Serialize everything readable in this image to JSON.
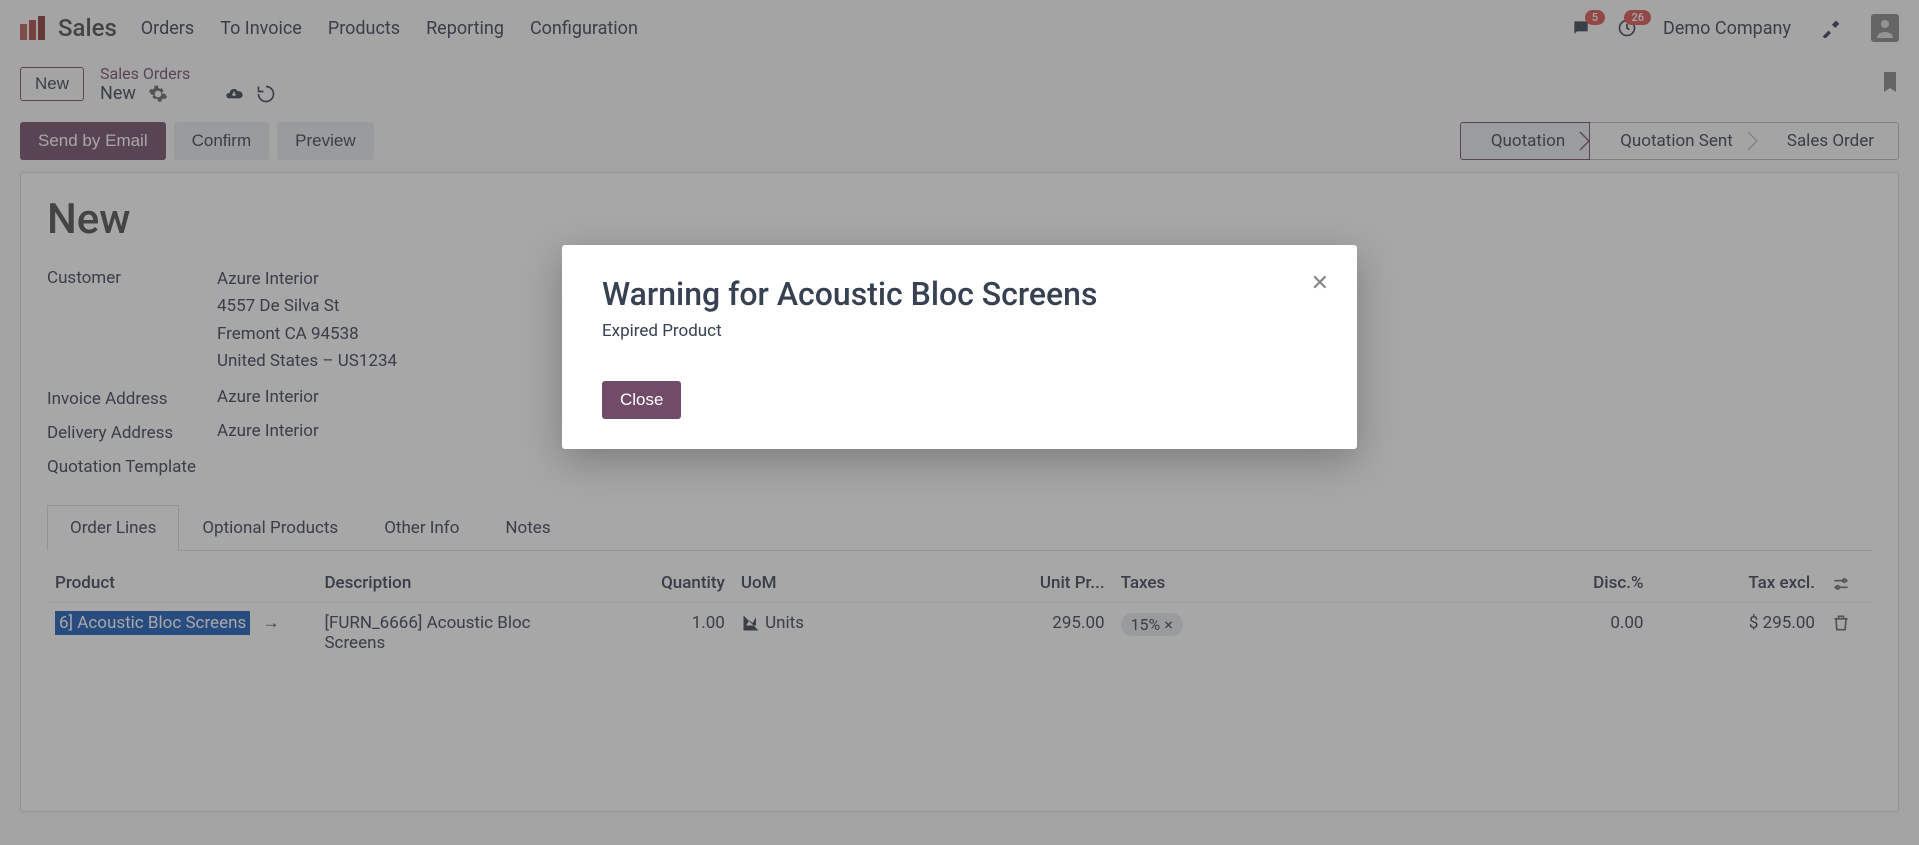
{
  "brand": {
    "title": "Sales"
  },
  "nav": [
    "Orders",
    "To Invoice",
    "Products",
    "Reporting",
    "Configuration"
  ],
  "badges": {
    "messages": "5",
    "activities": "26"
  },
  "company": "Demo Company",
  "breadcrumb": {
    "parent": "Sales Orders",
    "current": "New",
    "new_button": "New"
  },
  "actions": {
    "send": "Send by Email",
    "confirm": "Confirm",
    "preview": "Preview"
  },
  "status_steps": [
    "Quotation",
    "Quotation Sent",
    "Sales Order"
  ],
  "sheet": {
    "title": "New",
    "fields": {
      "customer_label": "Customer",
      "customer_value": "Azure Interior",
      "customer_addr": [
        "4557 De Silva St",
        "Fremont CA 94538",
        "United States – US1234"
      ],
      "invoice_label": "Invoice Address",
      "invoice_value": "Azure Interior",
      "delivery_label": "Delivery Address",
      "delivery_value": "Azure Interior",
      "quote_tpl_label": "Quotation Template"
    }
  },
  "tabs": [
    "Order Lines",
    "Optional Products",
    "Other Info",
    "Notes"
  ],
  "table": {
    "headers": {
      "product": "Product",
      "description": "Description",
      "quantity": "Quantity",
      "uom": "UoM",
      "unit_price": "Unit Pr...",
      "taxes": "Taxes",
      "disc": "Disc.%",
      "tax_excl": "Tax excl."
    },
    "row": {
      "product": "6] Acoustic Bloc Screens",
      "description": "[FURN_6666] Acoustic Bloc Screens",
      "quantity": "1.00",
      "uom": "Units",
      "unit_price": "295.00",
      "tax_tag": "15% ×",
      "disc": "0.00",
      "tax_excl": "$ 295.00"
    }
  },
  "modal": {
    "title": "Warning for Acoustic Bloc Screens",
    "message": "Expired Product",
    "close": "Close"
  }
}
